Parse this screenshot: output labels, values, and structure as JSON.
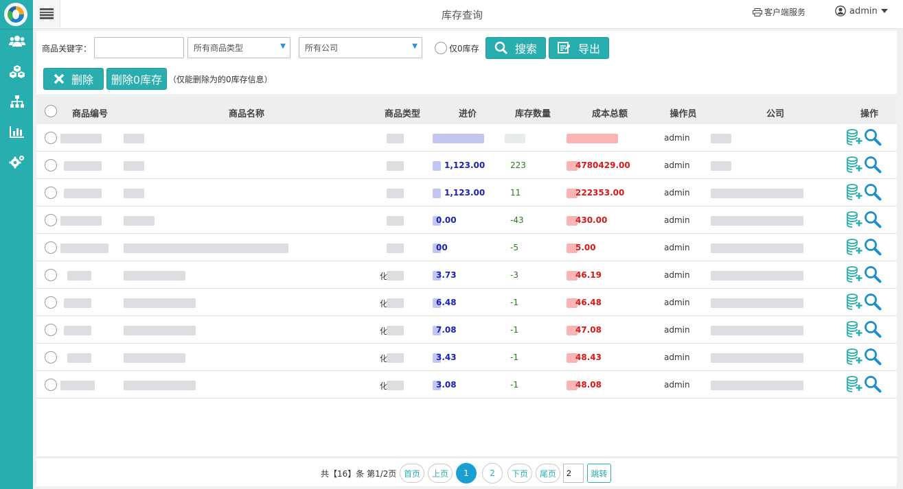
{
  "header": {
    "title": "库存查询",
    "service_label": "客户端服务",
    "user_label": "admin"
  },
  "filters": {
    "keyword_label": "商品关键字：",
    "keyword_value": "",
    "category_select": "所有商品类型",
    "company_select": "所有公司",
    "zero_stock_label": "仅0库存",
    "search_label": "搜索",
    "export_label": "导出",
    "delete_label": "删除",
    "delete_zero_label": "删除0库存",
    "note": "（仅能删除为的0库存信息）"
  },
  "table": {
    "columns": [
      "商品编号",
      "商品名称",
      "商品类型",
      "进价",
      "库存数量",
      "成本总额",
      "操作员",
      "公司",
      "操作"
    ],
    "rows": [
      {
        "category": "",
        "price": "",
        "qty": "",
        "cost": "",
        "operator": "admin"
      },
      {
        "category": "",
        "price": "1,123.00",
        "qty": "223",
        "cost": "4780429.00",
        "operator": "admin"
      },
      {
        "category": "",
        "price": "1,123.00",
        "qty": "11",
        "cost": "222353.00",
        "operator": "admin"
      },
      {
        "category": "",
        "price": "0.00",
        "qty": "-43",
        "cost": "430.00",
        "operator": "admin"
      },
      {
        "category": "",
        "price": "00",
        "qty": "-5",
        "cost": "5.00",
        "operator": "admin"
      },
      {
        "category": "化",
        "price": "3.73",
        "qty": "-3",
        "cost": "46.19",
        "operator": "admin"
      },
      {
        "category": "化",
        "price": "6.48",
        "qty": "-1",
        "cost": "46.48",
        "operator": "admin"
      },
      {
        "category": "化",
        "price": "7.08",
        "qty": "-1",
        "cost": "47.08",
        "operator": "admin"
      },
      {
        "category": "化",
        "price": "3.43",
        "qty": "-1",
        "cost": "48.43",
        "operator": "admin"
      },
      {
        "category": "化",
        "price": "3.08",
        "qty": "-1",
        "cost": "48.08",
        "operator": "admin"
      }
    ]
  },
  "pager": {
    "summary": "共【16】条 第1/2页",
    "first": "首页",
    "prev": "上页",
    "page1": "1",
    "page2": "2",
    "next": "下页",
    "last": "尾页",
    "jump_value": "2",
    "jump_label": "跳转"
  },
  "colors": {
    "accent": "#29aeb0",
    "price": "#1b22b8",
    "cost": "#d81818",
    "qty": "#2b7a1c",
    "active_page": "#1a9fd3"
  }
}
